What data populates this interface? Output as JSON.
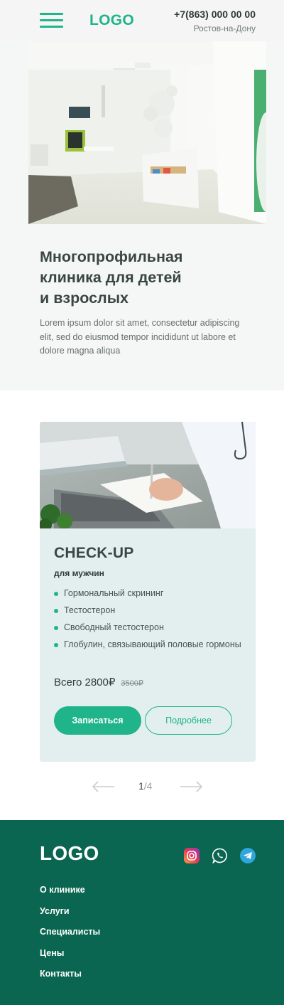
{
  "header": {
    "logo": "LOGO",
    "phone": "+7(863) 000 00 00",
    "city": "Ростов-на-Дону"
  },
  "hero": {
    "title_line1": "Многопрофильная",
    "title_line2": "клиника для детей",
    "title_line3": "и взрослых",
    "text": "Lorem ipsum dolor sit amet, consectetur adipiscing elit, sed do eiusmod tempor incididunt ut labore et dolore magna aliqua"
  },
  "card": {
    "title": "CHECK-UP",
    "subtitle": "для мужчин",
    "features": [
      "Гормональный скрининг",
      "Тестостерон",
      "Свободный тестостерон",
      "Глобулин, связывающий половые гормоны"
    ],
    "price": "Всего 2800₽",
    "old_price": "3500₽",
    "primary_button": "Записаться",
    "secondary_button": "Подробнее"
  },
  "pager": {
    "current": "1",
    "total": "/4"
  },
  "footer": {
    "logo": "LOGO",
    "nav": [
      "О клинике",
      "Услуги",
      "Специалисты",
      "Цены",
      "Контакты"
    ]
  },
  "colors": {
    "accent": "#1fb48a",
    "footer_bg": "#0a6650",
    "card_bg": "#e2efee"
  },
  "icons": {
    "menu": "hamburger-icon",
    "prev": "arrow-left-icon",
    "next": "arrow-right-icon",
    "social": [
      "instagram-icon",
      "whatsapp-icon",
      "telegram-icon"
    ]
  }
}
